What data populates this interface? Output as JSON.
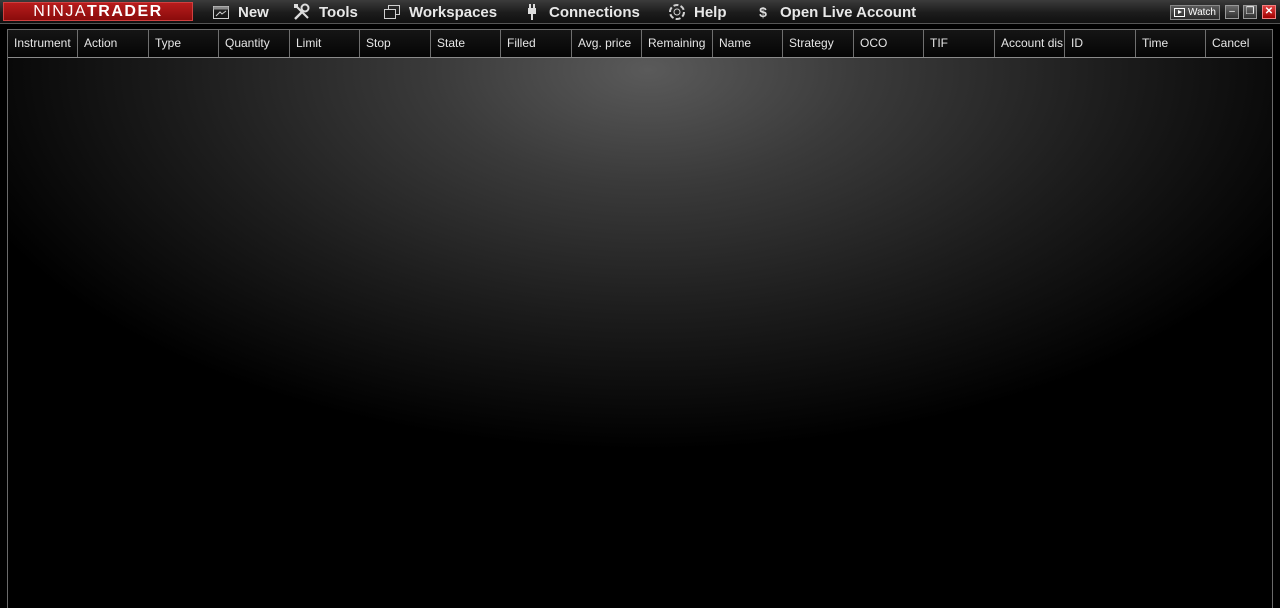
{
  "app": {
    "logo_light": "NINJA",
    "logo_bold": "TRADER"
  },
  "menu": {
    "new": "New",
    "tools": "Tools",
    "workspaces": "Workspaces",
    "connections": "Connections",
    "help": "Help",
    "open_live_account": "Open Live Account",
    "dollar_symbol": "$"
  },
  "window_controls": {
    "watch": "Watch",
    "minimize": "–",
    "restore": "❐",
    "close": "✕"
  },
  "orders_grid": {
    "columns": [
      "Instrument",
      "Action",
      "Type",
      "Quantity",
      "Limit",
      "Stop",
      "State",
      "Filled",
      "Avg. price",
      "Remaining",
      "Name",
      "Strategy",
      "OCO",
      "TIF",
      "Account dis",
      "ID",
      "Time",
      "Cancel"
    ],
    "rows": []
  },
  "colors": {
    "logo_red": "#b81c1c",
    "background": "#000000",
    "header_text": "#e6e6e6",
    "close_red": "#d02020"
  }
}
